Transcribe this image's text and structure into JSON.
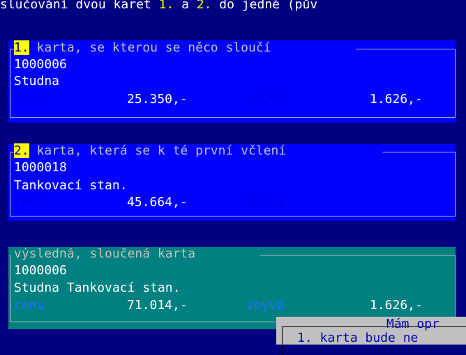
{
  "header": {
    "prefix": "slučování dvou karet ",
    "card1_ref": "1.",
    "mid": " a ",
    "card2_ref": "2.",
    "suffix": " do jedné (pův"
  },
  "card1": {
    "number": "1.",
    "title": " karta, se kterou se něco sloučí",
    "code": "1000006",
    "name": "Studna",
    "price_label": "cena",
    "price": "25.350,-",
    "remaining_label": "zbývá",
    "remaining": "1.626,-"
  },
  "card2": {
    "number": "2.",
    "title": " karta, která se k té první včlení",
    "code": "1000018",
    "name": "Tankovací stan.",
    "price_label": "cena",
    "price": "45.664,-",
    "remaining_label": "zbývá"
  },
  "result": {
    "title": "výsledná, sloučená karta",
    "code": "1000006",
    "name": "Studna Tankovací stan.",
    "price_label": "cena",
    "price": "71.014,-",
    "remaining_label": "zbývá",
    "remaining": "1.626,-"
  },
  "dialog": {
    "title": "Mám opr",
    "line1": "1. karta bude ne"
  }
}
